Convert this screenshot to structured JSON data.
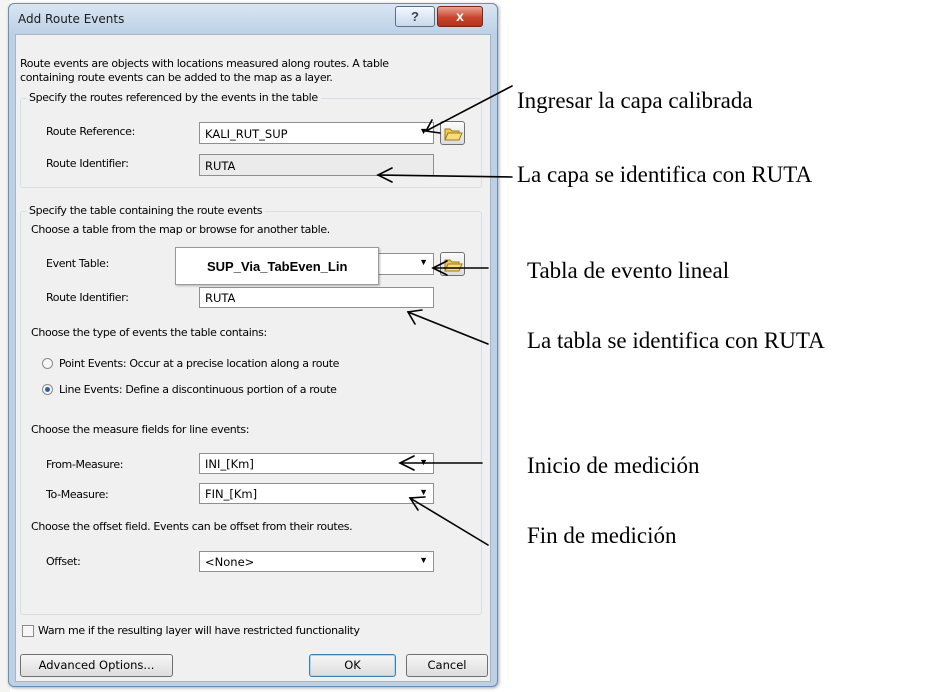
{
  "window": {
    "title": "Add Route Events",
    "help_label": "?",
    "close_label": "x"
  },
  "intro": {
    "line1": "Route events are objects with locations measured along routes. A table",
    "line2": "containing route events can be added to the map as a layer."
  },
  "routes_group": {
    "legend": "Specify the routes referenced by the events in the table",
    "route_reference_label": "Route Reference:",
    "route_reference_value": "KALI_RUT_SUP",
    "route_identifier_label": "Route Identifier:",
    "route_identifier_value": "RUTA"
  },
  "table_group": {
    "legend": "Specify the table containing the route events",
    "choose_table_text": "Choose a table from the map or browse for another table.",
    "event_table_label": "Event Table:",
    "event_table_popup": "SUP_Via_TabEven_Lin",
    "route_identifier_label": "Route Identifier:",
    "route_identifier_value": "RUTA",
    "event_type_text": "Choose the type of events the table contains:",
    "point_events_label": "Point Events: Occur at a precise location along a route",
    "line_events_label": "Line Events: Define a discontinuous portion of a route",
    "selected_event_type": "line",
    "measure_fields_text": "Choose the measure fields for line events:",
    "from_measure_label": "From-Measure:",
    "from_measure_value": "INI_[Km]",
    "to_measure_label": "To-Measure:",
    "to_measure_value": "FIN_[Km]",
    "offset_text": "Choose the offset field. Events can be offset from their routes.",
    "offset_label": "Offset:",
    "offset_value": "<None>"
  },
  "warn_label": "Warn me if the resulting layer will have restricted functionality",
  "buttons": {
    "advanced": "Advanced Options...",
    "ok": "OK",
    "cancel": "Cancel"
  },
  "annotations": {
    "capa_calibrada": "Ingresar la capa calibrada",
    "capa_ruta": "La capa se identifica con  RUTA",
    "tabla_evento": "Tabla de evento lineal",
    "tabla_ruta": "La tabla se identifica con RUTA",
    "inicio": "Inicio de medición",
    "fin": "Fin de medición"
  }
}
